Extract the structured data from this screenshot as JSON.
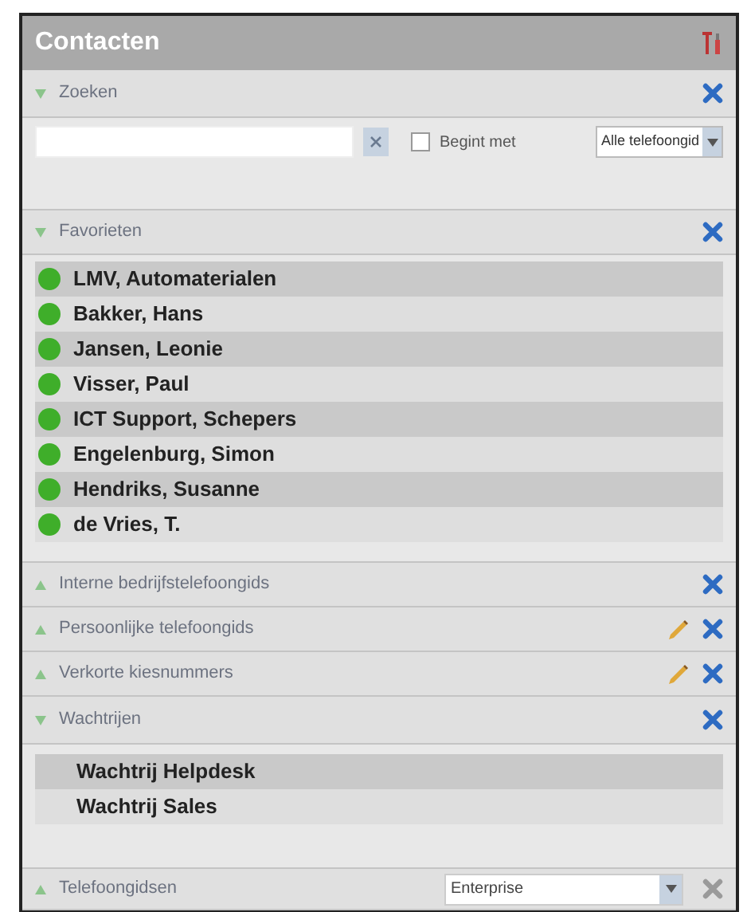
{
  "window": {
    "title": "Contacten"
  },
  "search": {
    "title": "Zoeken",
    "expanded": true,
    "starts_with_label": "Begint met",
    "starts_with_checked": false,
    "scope": "Alle telefoongid"
  },
  "favorites": {
    "title": "Favorieten",
    "expanded": true,
    "contacts": [
      {
        "name": "LMV, Automaterialen",
        "online": true
      },
      {
        "name": "Bakker, Hans",
        "online": true
      },
      {
        "name": "Jansen, Leonie",
        "online": true
      },
      {
        "name": "Visser, Paul",
        "online": true
      },
      {
        "name": "ICT Support, Schepers",
        "online": true
      },
      {
        "name": "Engelenburg, Simon",
        "online": true
      },
      {
        "name": "Hendriks, Susanne",
        "online": true
      },
      {
        "name": "de Vries, T.",
        "online": true
      }
    ]
  },
  "sections": [
    {
      "title": "Interne bedrijfstelefoongids",
      "expanded": false,
      "editable": false
    },
    {
      "title": "Persoonlijke telefoongids",
      "expanded": false,
      "editable": true
    },
    {
      "title": "Verkorte kiesnummers",
      "expanded": false,
      "editable": true
    }
  ],
  "queues": {
    "title": "Wachtrijen",
    "expanded": true,
    "items": [
      "Wachtrij Helpdesk",
      "Wachtrij Sales"
    ]
  },
  "phonebooks": {
    "title": "Telefoongidsen",
    "expanded": false,
    "selection": "Enterprise",
    "close_disabled": true
  }
}
